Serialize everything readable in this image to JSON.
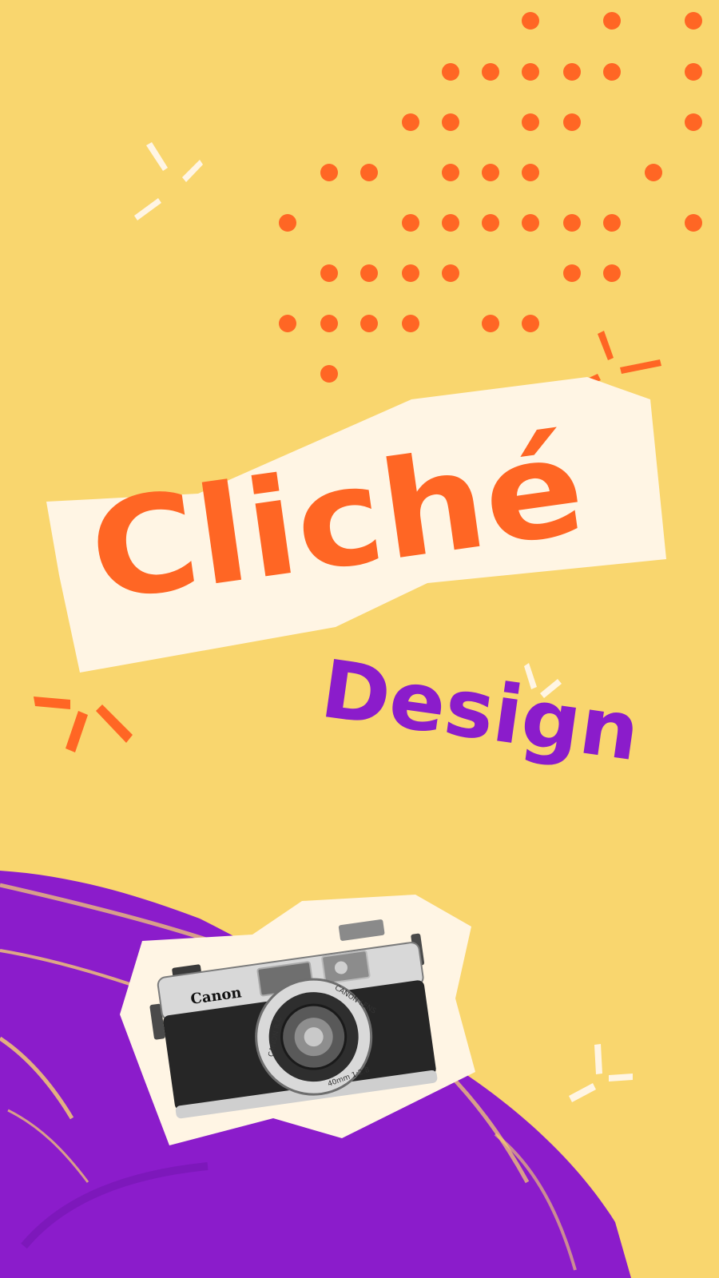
{
  "poster": {
    "title": "Cliché",
    "subtitle": "Design",
    "camera": {
      "brand": "Canon",
      "lens_ring_top": "CANON LENS",
      "lens_ring_left": "CANON R.C",
      "lens_ring_bottom": "40mm 1:2.8"
    }
  },
  "colors": {
    "background": "#f9d66e",
    "accent_orange": "#ff6624",
    "accent_purple": "#8b1ccb",
    "paper": "#fff5e4"
  }
}
